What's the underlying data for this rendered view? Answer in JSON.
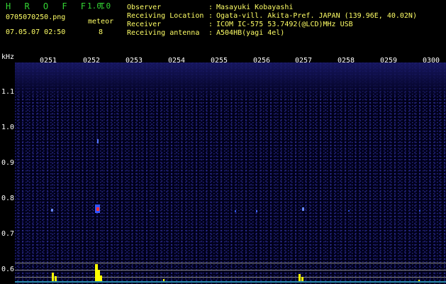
{
  "app": {
    "title": "H R O F F T",
    "version": "1.0.0"
  },
  "file": {
    "name": "0705070250.png",
    "datetime": "07.05.07 02:50"
  },
  "meteor": {
    "label": "meteor",
    "count": "8"
  },
  "info": [
    {
      "key": "Observer",
      "value": "Masayuki Kobayashi"
    },
    {
      "key": "Receiving Location",
      "value": "Ogata-vill. Akita-Pref. JAPAN (139.96E, 40.02N)"
    },
    {
      "key": "Receiver",
      "value": "ICOM IC-575 53.7492(@LCD)MHz USB"
    },
    {
      "key": "Receiving antenna",
      "value": "A504HB(yagi 4el)"
    }
  ],
  "info_separator": ":",
  "axis": {
    "unit": "kHz",
    "freq_ticks": [
      "1.1",
      "1.0",
      "0.9",
      "0.8",
      "0.7",
      "0.6"
    ],
    "time_ticks": [
      "0251",
      "0252",
      "0253",
      "0254",
      "0255",
      "0256",
      "0257",
      "0258",
      "0259",
      "0300"
    ]
  },
  "colors": {
    "title": "#33d433",
    "labels": "#ffff66",
    "background": "#000000",
    "spectrogram_bg": "#00001a",
    "baseline": "#2a8aaa",
    "peaks": "#ffff00"
  }
}
